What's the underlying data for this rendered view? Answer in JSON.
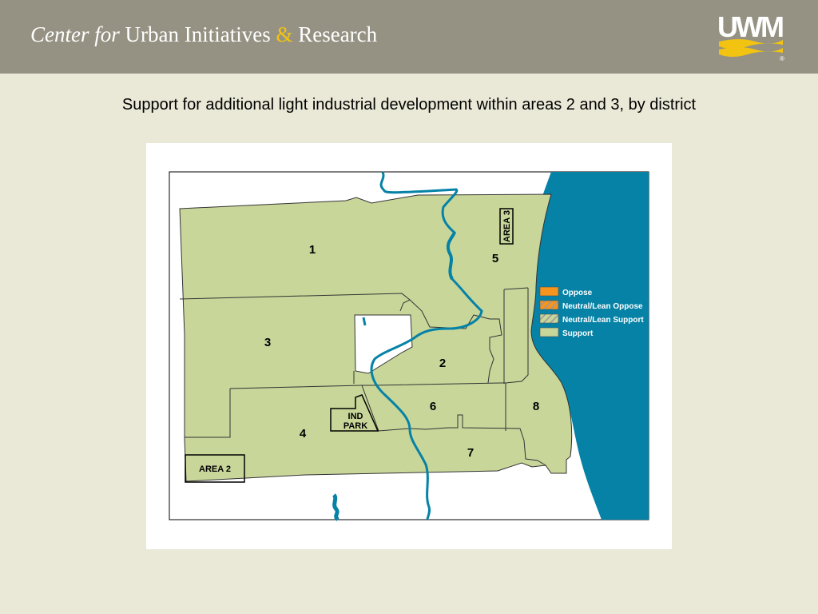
{
  "header": {
    "brand_lead": "Center for",
    "brand_name_part1": "Urban Initiatives",
    "brand_amp": "&",
    "brand_name_part2": "Research",
    "logo_text": "UWM",
    "logo_mark": "®"
  },
  "slide": {
    "title": "Support for additional light industrial development within areas 2 and 3, by district"
  },
  "map": {
    "districts": [
      {
        "id": "1",
        "label": "1",
        "category": "Support"
      },
      {
        "id": "2",
        "label": "2",
        "category": "Support"
      },
      {
        "id": "3",
        "label": "3",
        "category": "Support"
      },
      {
        "id": "4",
        "label": "4",
        "category": "Support"
      },
      {
        "id": "5",
        "label": "5",
        "category": "Support"
      },
      {
        "id": "6",
        "label": "6",
        "category": "Support"
      },
      {
        "id": "7",
        "label": "7",
        "category": "Support"
      },
      {
        "id": "8",
        "label": "8",
        "category": "Support"
      }
    ],
    "area_labels": {
      "area2": "AREA 2",
      "area3": "AREA 3",
      "ind_park_line1": "IND",
      "ind_park_line2": "PARK"
    },
    "legend": [
      {
        "label": "Oppose",
        "color": "#f7941d",
        "pattern": "solid"
      },
      {
        "label": "Neutral/Lean Oppose",
        "color": "#f7941d",
        "pattern": "hatched"
      },
      {
        "label": "Neutral/Lean Support",
        "color": "#c8d69a",
        "pattern": "hatched"
      },
      {
        "label": "Support",
        "color": "#c8d69a",
        "pattern": "solid"
      }
    ],
    "colors": {
      "support": "#c8d69a",
      "water": "#0582a6",
      "header": "#959283",
      "accent": "#f2c311",
      "background": "#eae8d7"
    }
  }
}
